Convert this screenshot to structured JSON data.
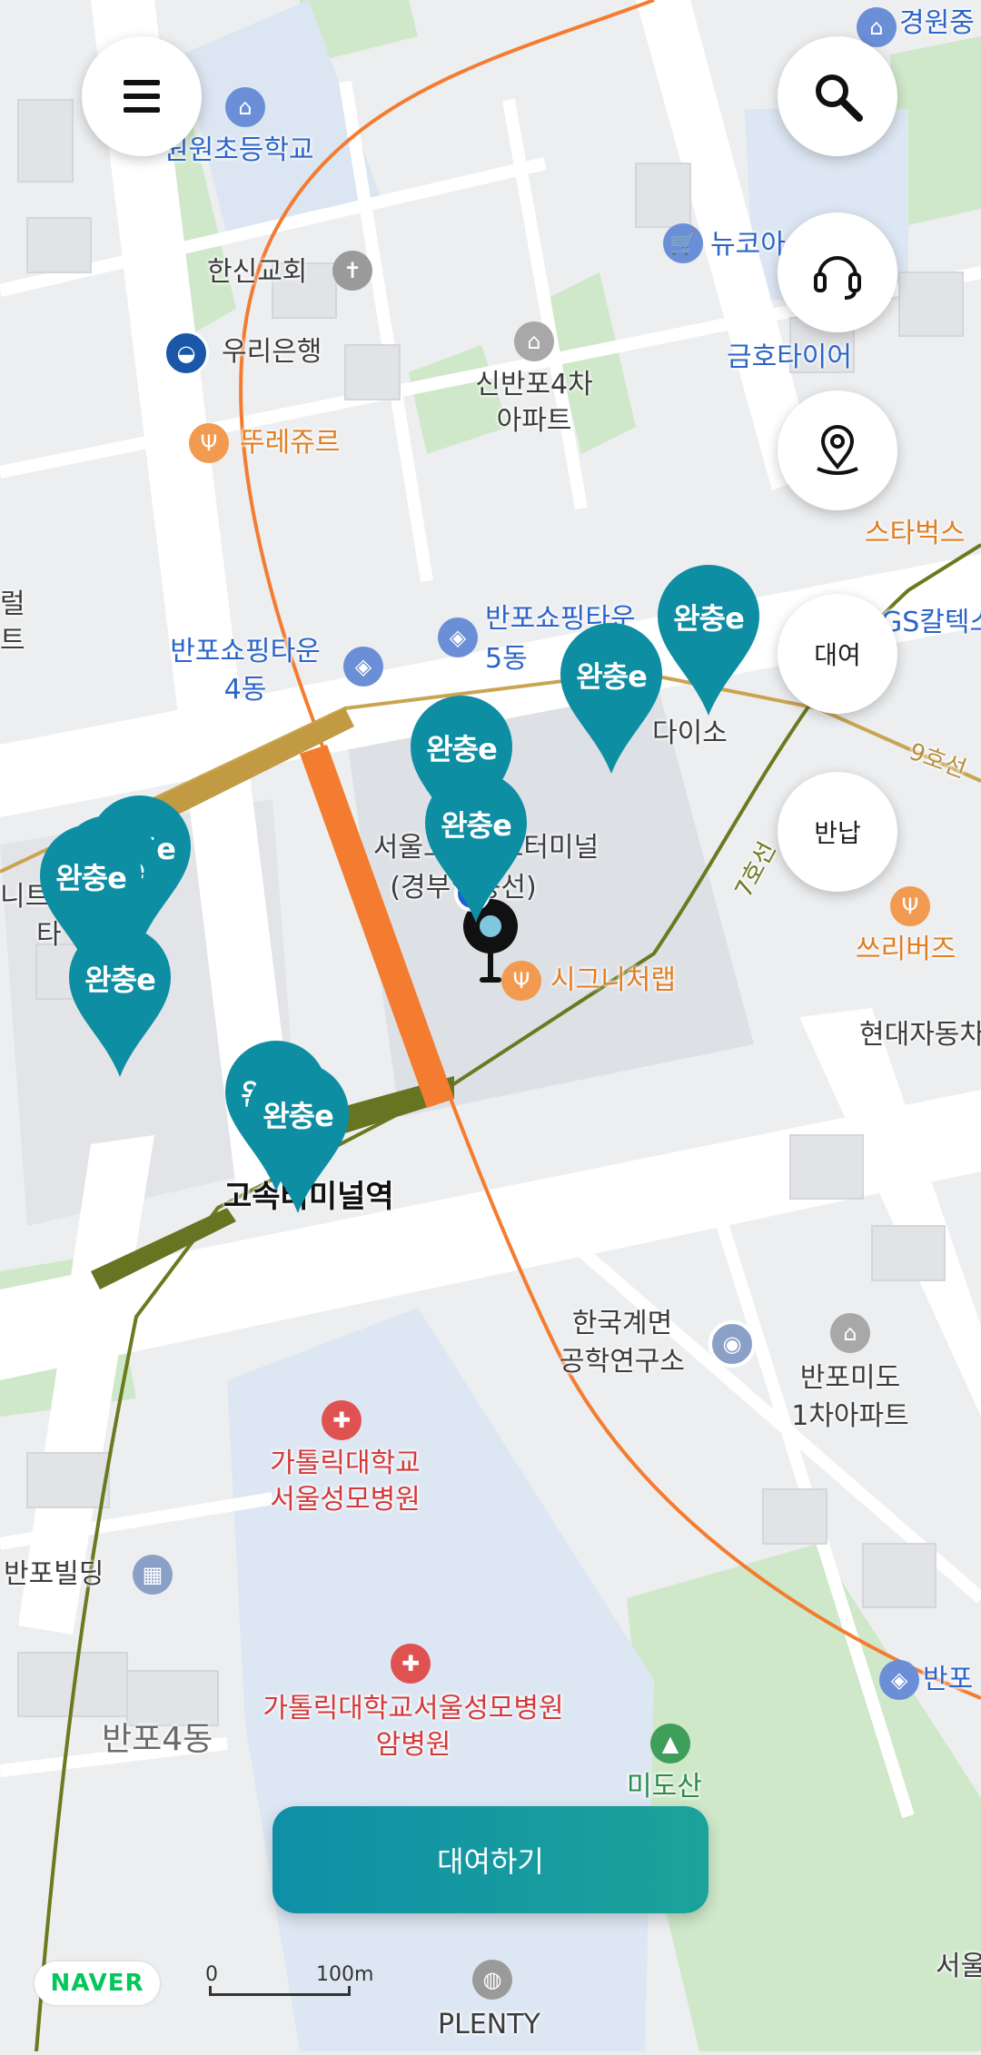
{
  "map_labels": {
    "gyeongwon": "경원중",
    "school": "원원초등학교",
    "church": "한신교회",
    "bank": "우리은행",
    "bakery": "뚜레쥬르",
    "newcore": "뉴코아",
    "apt4_line1": "신반포4차",
    "apt4_line2": "아파트",
    "geumho": "금호타이어",
    "starbucks": "스타벅스",
    "banpo_shop4_l1": "반포쇼핑타운",
    "banpo_shop4_l2": "4동",
    "banpo_shop5_l1": "반포쇼핑타운",
    "banpo_shop5_l2": "5동",
    "gs": "GS칼텍스",
    "daiso": "다이소",
    "line9": "9호선",
    "line7": "7호선",
    "terminal_l1": "서울고속버스터미널",
    "terminal_l2": "(경부영동선)",
    "signature": "시그니처랩",
    "threebirds": "쓰리버즈",
    "hyundai": "현대자동차",
    "station": "고속터미널역",
    "kicet_l1": "한국계면",
    "kicet_l2": "공학연구소",
    "midoapt_l1": "반포미도",
    "midoapt_l2": "1차아파트",
    "hospital_l1": "가톨릭대학교",
    "hospital_l2": "서울성모병원",
    "cancer_l1": "가톨릭대학교서울성모병원",
    "cancer_l2": "암병원",
    "banpo_bldg": "반포빌딩",
    "banpo4dong": "반포4동",
    "midosan": "미도산",
    "plenty": "PLENTY",
    "seoul_right": "서울",
    "banpo_right": "반포",
    "left_edge_1": "럴",
    "left_edge_2": "트",
    "left_edge_3": "니트",
    "left_edge_4": "타"
  },
  "markers": {
    "brand_label": "완충e"
  },
  "buttons": {
    "menu_icon": "menu-icon",
    "search_icon": "search-icon",
    "support_icon": "headset-icon",
    "location_icon": "location-pin-icon",
    "rent_label": "대여",
    "return_label": "반납",
    "cta_label": "대여하기"
  },
  "footer": {
    "naver": "NAVER",
    "scale_start": "0",
    "scale_end": "100m"
  },
  "colors": {
    "marker": "#0e8ea3",
    "cta": "#1ba39a",
    "line3": "#f47c30",
    "line7": "#6b7a1e",
    "line9": "#c9a552"
  }
}
